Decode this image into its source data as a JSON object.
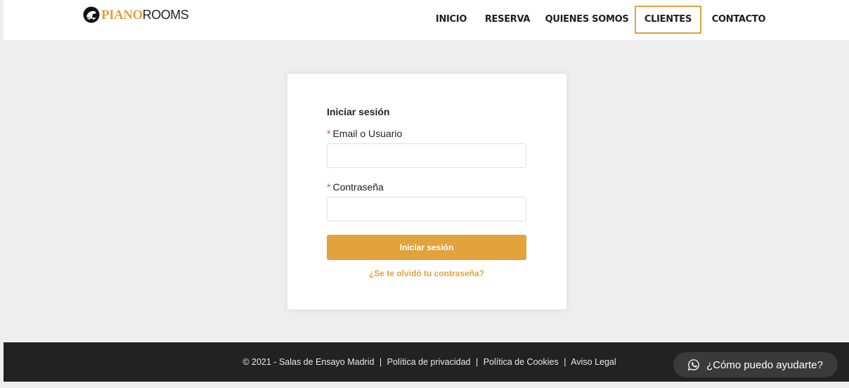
{
  "brand": {
    "part1": "PIANO",
    "part2": "ROOMS"
  },
  "nav": {
    "items": [
      {
        "label": "INICIO"
      },
      {
        "label": "RESERVA"
      },
      {
        "label": "QUIENES SOMOS"
      },
      {
        "label": "CLIENTES"
      },
      {
        "label": "CONTACTO"
      }
    ],
    "active": "CLIENTES"
  },
  "login": {
    "title": "Iniciar sesión",
    "required_mark": "*",
    "email_label": "Email o Usuario",
    "email_value": "",
    "password_label": "Contraseña",
    "password_value": "",
    "submit_label": "Iniciar sesión",
    "forgot_label": "¿Se te olvidó tu contraseña?"
  },
  "footer": {
    "copyright": "© 2021 - Salas de Ensayo Madrid",
    "links": [
      "Política de privacidad",
      "Política de Cookies",
      "Aviso Legal"
    ],
    "separator": "|"
  },
  "whatsapp": {
    "label": "¿Cómo puedo ayudarte?",
    "icon": "whatsapp-icon"
  },
  "colors": {
    "accent": "#e2a23c",
    "background": "#eeeeee",
    "footer_bg": "#222222",
    "required": "#e74c3c"
  }
}
